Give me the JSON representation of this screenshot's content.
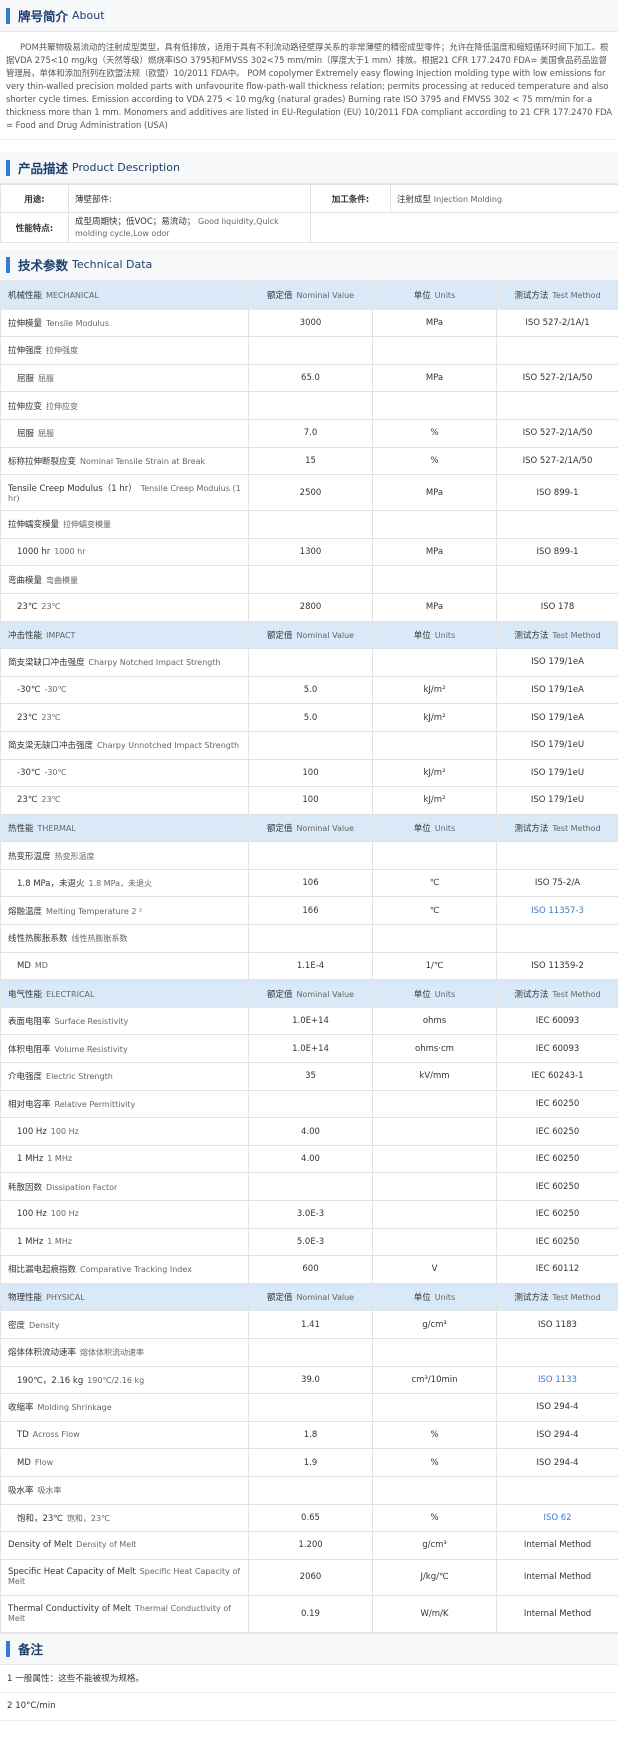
{
  "about": {
    "title_zh": "牌号简介",
    "title_en": "About",
    "text": "POM共聚物极易流动的注射成型类型，具有低排放，适用于具有不利流动路径壁厚关系的非常薄壁的精密成型零件；允许在降低温度和缩短循环时间下加工。根据VDA 275<10 mg/kg（天然等级）燃烧率ISO 3795和FMVSS 302<75 mm/min（厚度大于1 mm）排放。根据21 CFR 177.2470 FDA= 美国食品药品监督管理局，单体和添加剂列在欧盟法规（欧盟）10/2011 FDA中。 POM copolymer Extremely easy flowing Injection molding type with low emissions for very thin-walled precision molded parts with unfavourite flow-path-wall thickness relation; permits processing at reduced temperature and also shorter cycle times. Emission according to VDA 275 < 10 mg/kg (natural grades) Burning rate ISO 3795 and FMVSS 302 < 75 mm/min for a thickness more than 1 mm. Monomers and additives are listed in EU-Regulation (EU) 10/2011 FDA compliant according to 21 CFR 177.2470 FDA = Food and Drug Administration (USA)"
  },
  "product": {
    "title_zh": "产品描述",
    "title_en": "Product Description",
    "use_label": "用途:",
    "use_value": "薄壁部件:",
    "process_label": "加工条件:",
    "process_value_zh": "注射成型",
    "process_value_en": "Injection Molding",
    "feature_label": "性能特点:",
    "feature_value_zh": "成型周期快；低VOC；易流动；",
    "feature_value_en": "Good liquidity,Quick molding cycle,Low odor"
  },
  "tech": {
    "title_zh": "技术参数",
    "title_en": "Technical Data",
    "rows": [
      {
        "t": "cat",
        "zh": "机械性能",
        "en": "MECHANICAL",
        "v_zh": "额定值",
        "v_en": "Nominal Value",
        "u_zh": "单位",
        "u_en": "Units",
        "m_zh": "测试方法",
        "m_en": "Test Method"
      },
      {
        "t": "row",
        "zh": "拉伸模量",
        "en": "Tensile Modulus",
        "v": "3000",
        "u": "MPa",
        "m": "ISO 527-2/1A/1"
      },
      {
        "t": "row",
        "zh": "拉伸强度",
        "en": "拉伸强度",
        "v": "",
        "u": "",
        "m": ""
      },
      {
        "t": "sub",
        "zh": "屈服",
        "en": "屈服",
        "v": "65.0",
        "u": "MPa",
        "m": "ISO 527-2/1A/50"
      },
      {
        "t": "row",
        "zh": "拉伸应变",
        "en": "拉伸应变",
        "v": "",
        "u": "",
        "m": ""
      },
      {
        "t": "sub",
        "zh": "屈服",
        "en": "屈服",
        "v": "7.0",
        "u": "%",
        "m": "ISO 527-2/1A/50"
      },
      {
        "t": "row",
        "zh": "标称拉伸断裂应变",
        "en": "Nominal Tensile Strain at Break",
        "v": "15",
        "u": "%",
        "m": "ISO 527-2/1A/50"
      },
      {
        "t": "tall",
        "zh": "Tensile Creep Modulus（1 hr）",
        "en": "Tensile Creep Modulus (1 hr)",
        "v": "2500",
        "u": "MPa",
        "m": "ISO 899-1"
      },
      {
        "t": "row",
        "zh": "拉伸蠕变模量",
        "en": "拉伸蠕变模量",
        "v": "",
        "u": "",
        "m": ""
      },
      {
        "t": "sub",
        "zh": "1000 hr",
        "en": "1000 hr",
        "v": "1300",
        "u": "MPa",
        "m": "ISO 899-1"
      },
      {
        "t": "row",
        "zh": "弯曲模量",
        "en": "弯曲模量",
        "v": "",
        "u": "",
        "m": ""
      },
      {
        "t": "sub",
        "zh": "23℃",
        "en": "23℃",
        "v": "2800",
        "u": "MPa",
        "m": "ISO 178"
      },
      {
        "t": "cat",
        "zh": "冲击性能",
        "en": "IMPACT",
        "v_zh": "额定值",
        "v_en": "Nominal Value",
        "u_zh": "单位",
        "u_en": "Units",
        "m_zh": "测试方法",
        "m_en": "Test Method"
      },
      {
        "t": "row",
        "zh": "简支梁缺口冲击强度",
        "en": "Charpy Notched Impact Strength",
        "v": "",
        "u": "",
        "m": "ISO 179/1eA"
      },
      {
        "t": "sub",
        "zh": "-30℃",
        "en": "-30℃",
        "v": "5.0",
        "u": "kJ/m²",
        "m": "ISO 179/1eA"
      },
      {
        "t": "sub",
        "zh": "23℃",
        "en": "23℃",
        "v": "5.0",
        "u": "kJ/m²",
        "m": "ISO 179/1eA"
      },
      {
        "t": "row",
        "zh": "简支梁无缺口冲击强度",
        "en": "Charpy Unnotched Impact Strength",
        "v": "",
        "u": "",
        "m": "ISO 179/1eU"
      },
      {
        "t": "sub",
        "zh": "-30℃",
        "en": "-30℃",
        "v": "100",
        "u": "kJ/m²",
        "m": "ISO 179/1eU"
      },
      {
        "t": "sub",
        "zh": "23℃",
        "en": "23℃",
        "v": "100",
        "u": "kJ/m²",
        "m": "ISO 179/1eU"
      },
      {
        "t": "cat",
        "zh": "热性能",
        "en": "THERMAL",
        "v_zh": "额定值",
        "v_en": "Nominal Value",
        "u_zh": "单位",
        "u_en": "Units",
        "m_zh": "测试方法",
        "m_en": "Test Method"
      },
      {
        "t": "row",
        "zh": "热变形温度",
        "en": "热变形温度",
        "v": "",
        "u": "",
        "m": ""
      },
      {
        "t": "sub",
        "zh": "1.8 MPa，未退火",
        "en": "1.8 MPa，未退火",
        "v": "106",
        "u": "℃",
        "m": "ISO 75-2/A"
      },
      {
        "t": "row",
        "zh": "熔融温度",
        "en": "Melting Temperature  2 ²",
        "v": "166",
        "u": "℃",
        "m": "ISO 11357-3",
        "link": true
      },
      {
        "t": "row",
        "zh": "线性热膨胀系数",
        "en": "线性热膨胀系数",
        "v": "",
        "u": "",
        "m": ""
      },
      {
        "t": "sub",
        "zh": "MD",
        "en": "MD",
        "v": "1.1E-4",
        "u": "1/℃",
        "m": "ISO 11359-2"
      },
      {
        "t": "cat",
        "zh": "电气性能",
        "en": "ELECTRICAL",
        "v_zh": "额定值",
        "v_en": "Nominal Value",
        "u_zh": "单位",
        "u_en": "Units",
        "m_zh": "测试方法",
        "m_en": "Test Method"
      },
      {
        "t": "row",
        "zh": "表面电阻率",
        "en": "Surface Resistivity",
        "v": "1.0E+14",
        "u": "ohms",
        "m": "IEC 60093"
      },
      {
        "t": "row",
        "zh": "体积电阻率",
        "en": "Volume Resistivity",
        "v": "1.0E+14",
        "u": "ohms·cm",
        "m": "IEC 60093"
      },
      {
        "t": "row",
        "zh": "介电强度",
        "en": "Electric Strength",
        "v": "35",
        "u": "kV/mm",
        "m": "IEC 60243-1"
      },
      {
        "t": "row",
        "zh": "相对电容率",
        "en": "Relative Permittivity",
        "v": "",
        "u": "",
        "m": "IEC 60250"
      },
      {
        "t": "sub",
        "zh": "100 Hz",
        "en": "100 Hz",
        "v": "4.00",
        "u": "",
        "m": "IEC 60250"
      },
      {
        "t": "sub",
        "zh": "1 MHz",
        "en": "1 MHz",
        "v": "4.00",
        "u": "",
        "m": "IEC 60250"
      },
      {
        "t": "row",
        "zh": "耗散因数",
        "en": "Dissipation Factor",
        "v": "",
        "u": "",
        "m": "IEC 60250"
      },
      {
        "t": "sub",
        "zh": "100 Hz",
        "en": "100 Hz",
        "v": "3.0E-3",
        "u": "",
        "m": "IEC 60250"
      },
      {
        "t": "sub",
        "zh": "1 MHz",
        "en": "1 MHz",
        "v": "5.0E-3",
        "u": "",
        "m": "IEC 60250"
      },
      {
        "t": "row",
        "zh": "相比漏电起痕指数",
        "en": "Comparative Tracking Index",
        "v": "600",
        "u": "V",
        "m": "IEC 60112"
      },
      {
        "t": "cat",
        "zh": "物理性能",
        "en": "PHYSICAL",
        "v_zh": "额定值",
        "v_en": "Nominal Value",
        "u_zh": "单位",
        "u_en": "Units",
        "m_zh": "测试方法",
        "m_en": "Test Method"
      },
      {
        "t": "row",
        "zh": "密度",
        "en": "Density",
        "v": "1.41",
        "u": "g/cm³",
        "m": "ISO 1183"
      },
      {
        "t": "row",
        "zh": "熔体体积流动速率",
        "en": "熔体体积流动速率",
        "v": "",
        "u": "",
        "m": ""
      },
      {
        "t": "sub",
        "zh": "190℃，2.16 kg",
        "en": "190℃/2.16 kg",
        "v": "39.0",
        "u": "cm³/10min",
        "m": "ISO 1133",
        "link": true
      },
      {
        "t": "row",
        "zh": "收缩率",
        "en": "Molding Shrinkage",
        "v": "",
        "u": "",
        "m": "ISO 294-4"
      },
      {
        "t": "sub",
        "zh": "TD",
        "en": "Across Flow",
        "v": "1.8",
        "u": "%",
        "m": "ISO 294-4"
      },
      {
        "t": "sub",
        "zh": "MD",
        "en": "Flow",
        "v": "1.9",
        "u": "%",
        "m": "ISO 294-4"
      },
      {
        "t": "row",
        "zh": "吸水率",
        "en": "吸水率",
        "v": "",
        "u": "",
        "m": ""
      },
      {
        "t": "sub",
        "zh": "饱和，23℃",
        "en": "饱和，23℃",
        "v": "0.65",
        "u": "%",
        "m": "ISO 62",
        "link": true
      },
      {
        "t": "row",
        "zh": "Density of Melt",
        "en": "Density of Melt",
        "v": "1.200",
        "u": "g/cm³",
        "m": "Internal Method"
      },
      {
        "t": "tall",
        "zh": "Specific Heat Capacity of Melt",
        "en": "Specific Heat Capacity of Melt",
        "v": "2060",
        "u": "J/kg/℃",
        "m": "Internal Method"
      },
      {
        "t": "tall2",
        "zh": "Thermal Conductivity of Melt",
        "en": "Thermal Conductivity of Melt",
        "v": "0.19",
        "u": "W/m/K",
        "m": "Internal Method"
      }
    ]
  },
  "notes": {
    "title_zh": "备注",
    "items": [
      "1 一般属性：这些不能被视为规格。",
      "2 10°C/min"
    ]
  },
  "colors": {
    "accent": "#2f7bd6",
    "category_bg": "#d9e9f8",
    "link": "#3a79c8"
  }
}
